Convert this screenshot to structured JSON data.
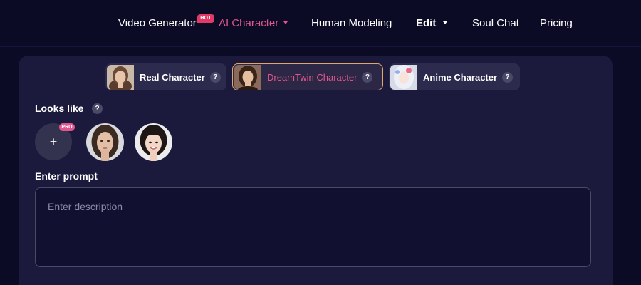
{
  "nav": {
    "video_generator": "Video Generator",
    "hot_badge": "HOT",
    "ai_character": "AI Character",
    "human_modeling": "Human Modeling",
    "edit": "Edit",
    "soul_chat": "Soul Chat",
    "pricing": "Pricing"
  },
  "tabs": [
    {
      "label": "Real Character",
      "help": "?"
    },
    {
      "label": "DreamTwin Character",
      "help": "?"
    },
    {
      "label": "Anime Character",
      "help": "?"
    }
  ],
  "looks_like": {
    "label": "Looks like",
    "help": "?",
    "add_symbol": "+",
    "pro_badge": "PRO"
  },
  "prompt": {
    "label": "Enter prompt",
    "placeholder": "Enter description",
    "value": ""
  },
  "colors": {
    "background": "#0c0b26",
    "panel": "#1b1a3c",
    "accent_pink": "#e0568f",
    "selected_border": "#e1a86a",
    "hot_red": "#e23a67"
  }
}
